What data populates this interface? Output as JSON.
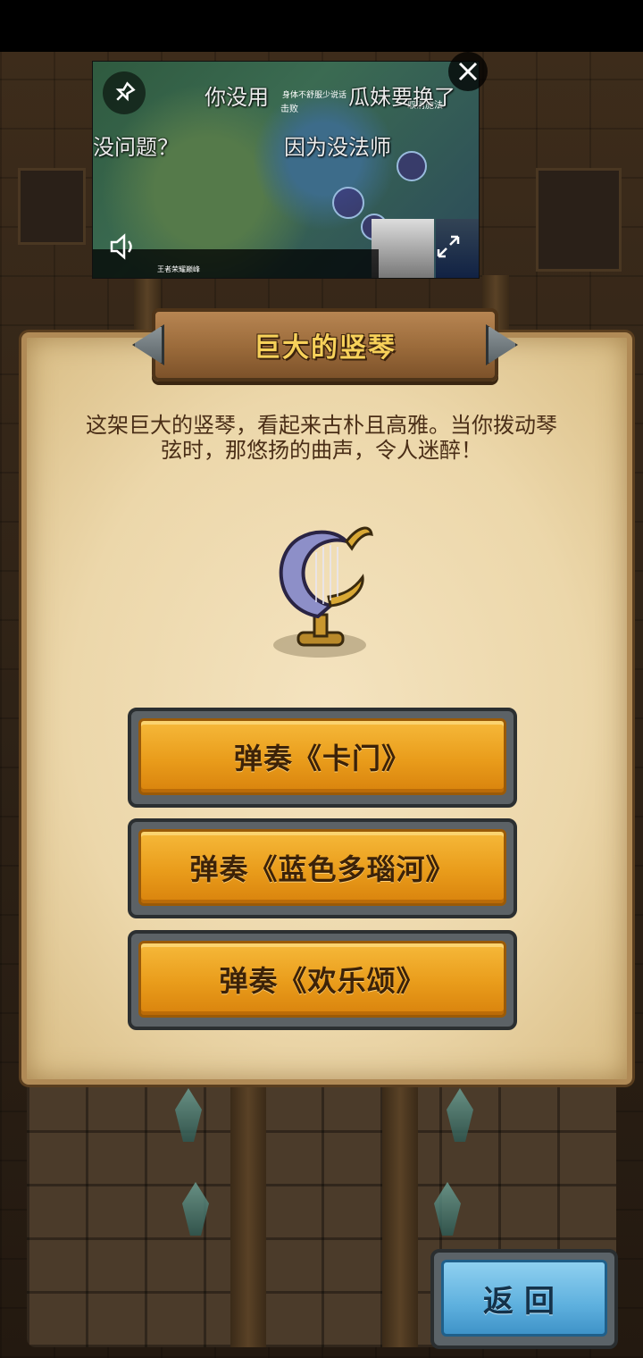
{
  "dialog": {
    "title": "巨大的竖琴",
    "description": "这架巨大的竖琴，看起来古朴且高雅。当你拨动琴弦时，那悠扬的曲声，令人迷醉！",
    "item_icon": "harp-icon",
    "options": [
      {
        "label": "弹奏《卡门》"
      },
      {
        "label": "弹奏《蓝色多瑙河》"
      },
      {
        "label": "弹奏《欢乐颂》"
      }
    ]
  },
  "back_button": {
    "label": "返回"
  },
  "video_overlay": {
    "danmaku": [
      "你没用",
      "瓜妹要换了",
      "没问题？",
      "因为没法师"
    ],
    "hud_center": "击败",
    "hud_notice": "身体不舒服少说话",
    "cancel_text": "取消施法",
    "stream_logo": "王者荣耀巅峰",
    "icons": {
      "pin": "pin-icon",
      "close": "close-icon",
      "speaker": "speaker-icon",
      "expand": "expand-icon"
    }
  },
  "colors": {
    "parchment": "#ecd7aa",
    "option_button": "#e99c1b",
    "back_button": "#5eb0de",
    "title_text": "#f7d15a"
  }
}
